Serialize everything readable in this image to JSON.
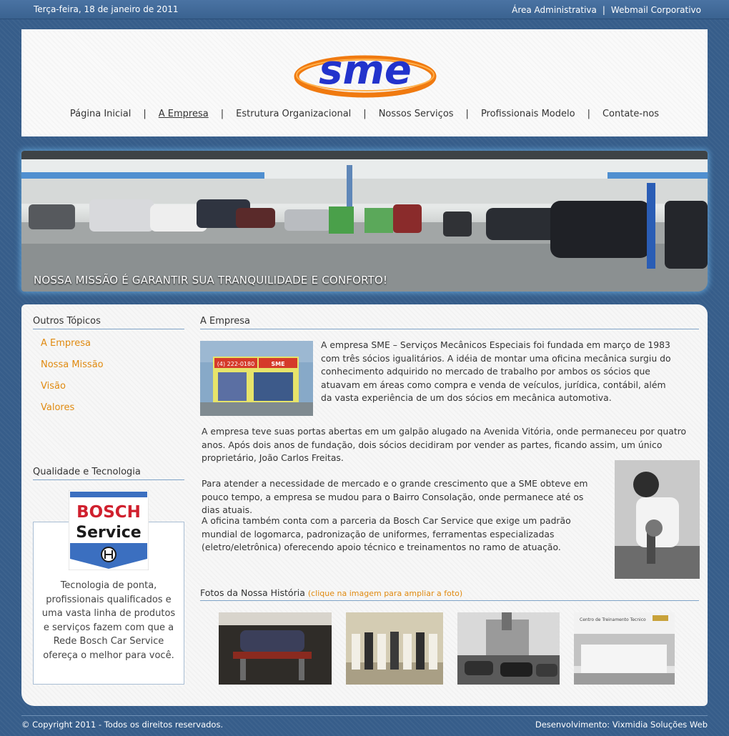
{
  "topbar": {
    "date": "Terça-feira, 18 de janeiro de 2011",
    "admin_link": "Área Administrativa",
    "separator": "|",
    "webmail_link": "Webmail Corporativo"
  },
  "logo": {
    "text": "sme"
  },
  "nav": {
    "separator": "|",
    "items": [
      {
        "label": "Página Inicial"
      },
      {
        "label": "A Empresa"
      },
      {
        "label": "Estrutura Organizacional"
      },
      {
        "label": "Nossos Serviços"
      },
      {
        "label": "Profissionais Modelo"
      },
      {
        "label": "Contate-nos"
      }
    ],
    "active": "A Empresa"
  },
  "banner": {
    "caption": "NOSSA MISSÃO É GARANTIR SUA TRANQUILIDADE E CONFORTO!"
  },
  "sidebar": {
    "topics_title": "Outros Tópicos",
    "topics": [
      {
        "label": "A Empresa"
      },
      {
        "label": "Nossa Missão"
      },
      {
        "label": "Visão"
      },
      {
        "label": "Valores"
      }
    ],
    "quality_title": "Qualidade e Tecnologia",
    "bosch_text": "Tecnologia de ponta, profissionais qualificados e uma vasta linha de produtos e serviços fazem com que a Rede Bosch Car Service ofereça o melhor para você."
  },
  "main": {
    "title": "A Empresa",
    "paragraphs": [
      "A empresa SME – Serviços Mecânicos Especiais foi fundada em março de 1983 com três sócios igualitários. A idéia de montar uma oficina mecânica surgiu do conhecimento adquirido no mercado de trabalho por ambos os sócios que atuavam em áreas como compra e venda de veículos, jurídica, contábil, além da vasta experiência de um dos sócios em mecânica automotiva.",
      "A empresa teve suas portas abertas em um galpão alugado na Avenida Vitória, onde permaneceu por quatro anos. Após dois anos de fundação, dois sócios decidiram por vender as partes, ficando assim, um único proprietário, João Carlos Freitas.",
      "Para atender a necessidade de mercado e o grande crescimento que a SME obteve em pouco tempo, a empresa se mudou para o Bairro Consolação, onde permanece até os dias atuais.",
      "A oficina também conta com a parceria da Bosch Car Service que exige um padrão mundial de logomarca, padronização de uniformes, ferramentas especializadas (eletro/eletrônica) oferecendo apoio técnico e treinamentos no ramo de atuação."
    ],
    "storefront_sign_phone": "(4) 222-0180",
    "storefront_sign_name": "SME",
    "fotos_title": "Fotos da Nossa História",
    "fotos_hint": "(clique na imagem para ampliar a foto)",
    "training_center_sign": "Centro de Treinamento Tecnico"
  },
  "bosch": {
    "line1": "BOSCH",
    "line2": "Service"
  },
  "footer": {
    "copyright": "© Copyright 2011 - Todos os direitos reservados.",
    "developer": "Desenvolvimento: Vixmidia Soluções Web"
  },
  "colors": {
    "accent_orange": "#e08a10",
    "page_blue": "#365d8a",
    "logo_blue": "#2233cc",
    "logo_orange": "#f07a10",
    "bosch_red": "#d0202e",
    "bosch_blue": "#3b6fc0"
  }
}
